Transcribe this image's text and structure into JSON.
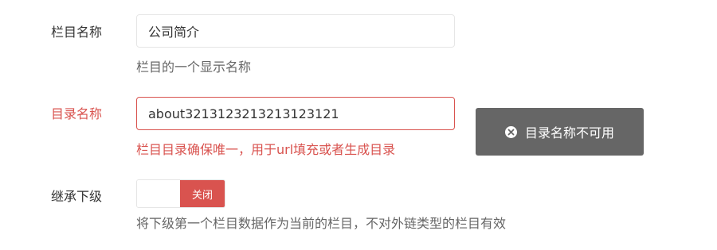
{
  "fields": {
    "column_name": {
      "label": "栏目名称",
      "value": "公司简介",
      "help": "栏目的一个显示名称"
    },
    "directory_name": {
      "label": "目录名称",
      "value": "about3213123213213123121",
      "error": "栏目目录确保唯一，用于url填充或者生成目录"
    },
    "inherit_sub": {
      "label": "继承下级",
      "toggle_state": "关闭",
      "help": "将下级第一个栏目数据作为当前的栏目，不对外链类型的栏目有效"
    }
  },
  "status_button": {
    "label": "目录名称不可用",
    "icon": "close-circle-icon"
  },
  "colors": {
    "error": "#d9534f",
    "button_bg": "#666666",
    "text": "#333333",
    "help": "#666666"
  }
}
